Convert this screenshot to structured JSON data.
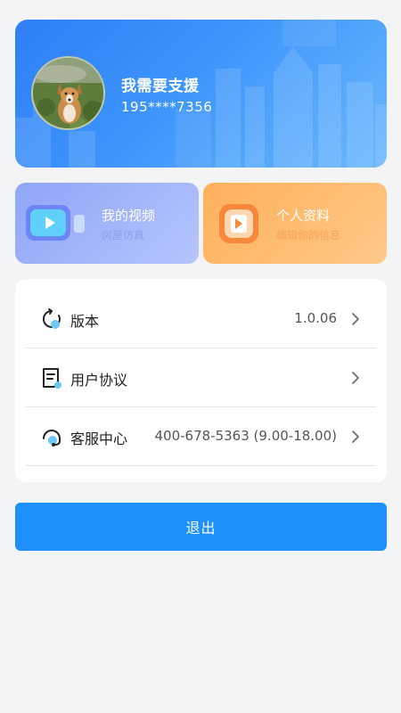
{
  "profile": {
    "name": "我需要支援",
    "phone": "195****7356"
  },
  "cards": {
    "video": {
      "title": "我的视频",
      "subtitle": "房屋仿真"
    },
    "profile": {
      "title": "个人资料",
      "subtitle": "编辑你的信息"
    }
  },
  "settings": {
    "version": {
      "label": "版本",
      "value": "1.0.06"
    },
    "agreement": {
      "label": "用户协议"
    },
    "support": {
      "label": "客服中心",
      "value": "400-678-5363 (9.00-18.00)"
    }
  },
  "logout_label": "退出",
  "colors": {
    "accent": "#1e90fb",
    "banner_start": "#2f7ef7",
    "video_card": "#8fa6f8",
    "profile_card": "#ffb15c",
    "background": "#f3f4f6"
  }
}
